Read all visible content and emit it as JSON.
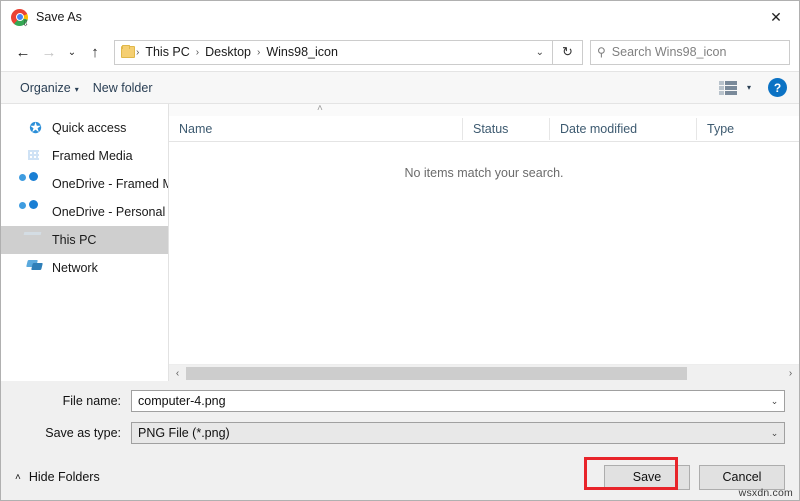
{
  "window": {
    "title": "Save As",
    "app_icon": "chrome-download-icon",
    "close_label": "✕"
  },
  "nav": {
    "back": "←",
    "forward": "→",
    "recent": "⌄",
    "up": "↑",
    "refresh": "↻",
    "breadcrumb_folder_icon": "folder-icon",
    "breadcrumbs": [
      "This PC",
      "Desktop",
      "Wins98_icon"
    ],
    "separator": "›",
    "dropdown_caret": "⌄"
  },
  "search": {
    "icon": "search-icon",
    "placeholder": "Search Wins98_icon"
  },
  "toolbar": {
    "organize_label": "Organize",
    "organize_caret": "▾",
    "new_folder_label": "New folder",
    "view_icon": "list-view-icon",
    "view_caret": "▾",
    "help_label": "?"
  },
  "sidebar": {
    "items": [
      {
        "label": "Quick access",
        "icon": "star-icon",
        "selected": false
      },
      {
        "label": "Framed Media",
        "icon": "library-icon",
        "selected": false
      },
      {
        "label": "OneDrive - Framed M",
        "icon": "cloud-icon",
        "selected": false
      },
      {
        "label": "OneDrive - Personal",
        "icon": "cloud-icon",
        "selected": false
      },
      {
        "label": "This PC",
        "icon": "computer-icon",
        "selected": true
      },
      {
        "label": "Network",
        "icon": "network-icon",
        "selected": false
      }
    ]
  },
  "filelist": {
    "sort_indicator": "˄",
    "columns": [
      "Name",
      "Status",
      "Date modified",
      "Type"
    ],
    "rows": [],
    "empty_message": "No items match your search.",
    "scroll_left": "‹",
    "scroll_right": "›"
  },
  "form": {
    "file_name_label": "File name:",
    "file_name_value": "computer-4.png",
    "file_name_caret": "⌄",
    "save_as_type_label": "Save as type:",
    "save_as_type_value": "PNG File (*.png)",
    "save_as_type_caret": "⌄"
  },
  "footer": {
    "hide_folders_caret": "˄",
    "hide_folders_label": "Hide Folders",
    "save_label": "Save",
    "cancel_label": "Cancel",
    "watermark": "wsxdn.com",
    "highlight_color": "#e8242a"
  }
}
